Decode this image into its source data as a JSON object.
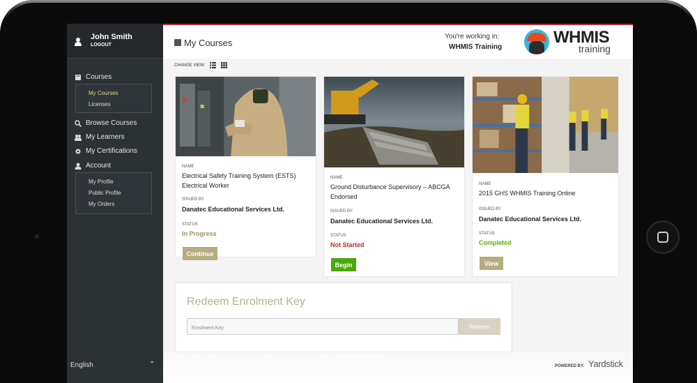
{
  "user": {
    "name": "John Smith",
    "logout": "LOGOUT"
  },
  "sidebar": {
    "courses": "Courses",
    "courses_sub": [
      "My Courses",
      "Licenses"
    ],
    "browse": "Browse Courses",
    "learners": "My Learners",
    "certifications": "My Certifications",
    "account": "Account",
    "account_sub": [
      "My Profile",
      "Public Profile",
      "My Orders"
    ],
    "language": "English"
  },
  "header": {
    "title": "My Courses",
    "working_label": "You're working in:",
    "working_org": "WHMIS Training",
    "logo_title": "WHMIS",
    "logo_sub": "training"
  },
  "change_view": "CHANGE VIEW:",
  "labels": {
    "name": "NAME",
    "issued_by": "ISSUED BY",
    "status": "STATUS"
  },
  "courses": [
    {
      "name": "Electrical Safety Training System (ESTS) Electrical Worker",
      "issuer": "Danatec Educational Services Ltd.",
      "status": "In Progress",
      "status_color": "#9c9360",
      "button": "Continue",
      "button_color": "#b5ac80"
    },
    {
      "name": "Ground Disturbance Supervisory – ABCGA Endorsed",
      "issuer": "Danatec Educational Services Ltd.",
      "status": "Not Started",
      "status_color": "#d11f1f",
      "button": "Begin",
      "button_color": "#4aa80a"
    },
    {
      "name": "2015 GHS WHMIS Training Online",
      "issuer": "Danatec Educational Services Ltd.",
      "status": "Completed",
      "status_color": "#5fae12",
      "button": "View",
      "button_color": "#b5ac80"
    }
  ],
  "redeem": {
    "title": "Redeem Enrolment Key",
    "placeholder": "Enrolment Key",
    "button": "Redeem"
  },
  "footer": {
    "powered_by": "POWERED BY:",
    "brand": "Yardstick"
  }
}
